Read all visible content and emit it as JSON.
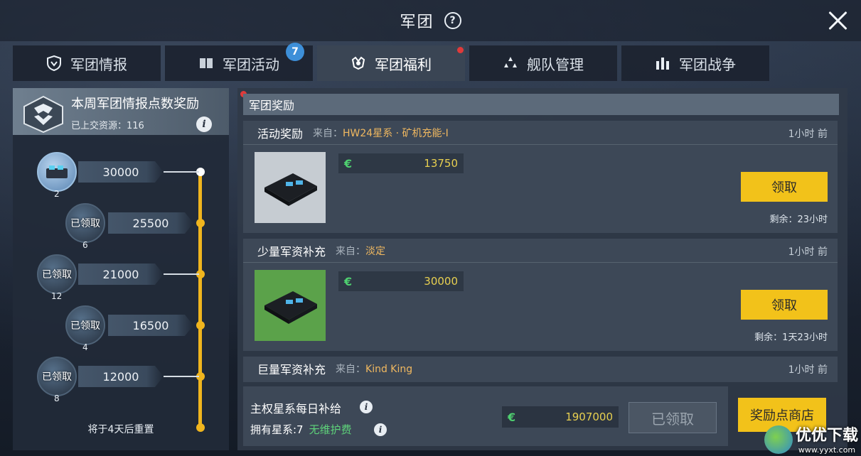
{
  "window": {
    "title": "军团"
  },
  "tabs": [
    {
      "label": "军团情报",
      "icon": "shield-icon"
    },
    {
      "label": "军团活动",
      "icon": "book-icon",
      "badge": "7"
    },
    {
      "label": "军团福利",
      "icon": "gift-icon",
      "active": true
    },
    {
      "label": "舰队管理",
      "icon": "fleet-icon"
    },
    {
      "label": "军团战争",
      "icon": "war-icon"
    }
  ],
  "left_panel": {
    "title": "本周军团情报点数奖励",
    "submitted": "已上交资源：116",
    "rewards": [
      {
        "value": "30000",
        "count": "2",
        "claimed": false
      },
      {
        "value": "25500",
        "count": "6",
        "claimed": true,
        "label": "已领取"
      },
      {
        "value": "21000",
        "count": "12",
        "claimed": true,
        "label": "已领取"
      },
      {
        "value": "16500",
        "count": "4",
        "claimed": true,
        "label": "已领取"
      },
      {
        "value": "12000",
        "count": "8",
        "claimed": true,
        "label": "已领取"
      }
    ],
    "reset_text": "将于4天后重置"
  },
  "right_panel": {
    "header": "军团奖励",
    "cards": [
      {
        "name": "活动奖励",
        "from_prefix": "来自：",
        "from": "HW24星系 · 矿机充能-I",
        "time": "1小时 前",
        "resource": "13750",
        "button": "领取",
        "remaining": "剩余：23小时"
      },
      {
        "name": "少量军资补充",
        "from_prefix": "来自：",
        "from": "淡定",
        "time": "1小时 前",
        "resource": "30000",
        "button": "领取",
        "remaining": "剩余：1天23小时"
      },
      {
        "name": "巨量军资补充",
        "from_prefix": "来自：",
        "from": "Kind King",
        "time": "1小时 前"
      }
    ],
    "daily": {
      "title": "主权星系每日补给",
      "owned": "拥有星系:7",
      "maintenance": "无维护费",
      "resource": "1907000",
      "claimed_label": "已领取"
    },
    "shop_button": "奖励点商店",
    "currency_symbol": "€"
  },
  "watermark": {
    "main": "优优下载",
    "url": "www.yyxt.com"
  },
  "colors": {
    "accent": "#f2c21a",
    "track": "#f0b51e",
    "badge": "#3d8fd8",
    "resource": "#4fd070"
  }
}
